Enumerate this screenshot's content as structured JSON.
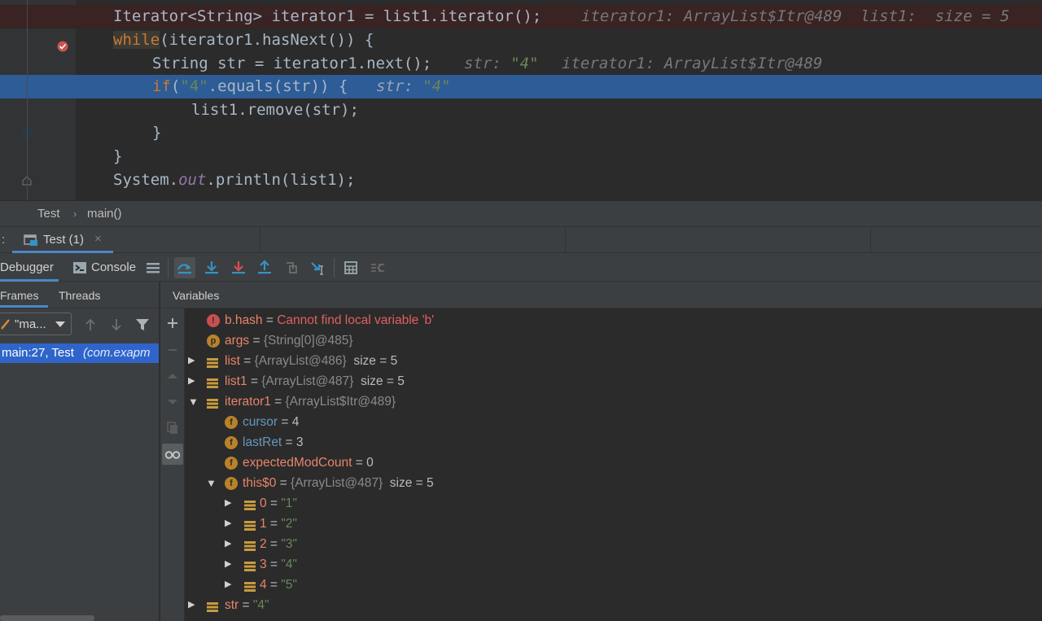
{
  "editor": {
    "lines": [
      {
        "code": "Iterator<String> iterator1 = list1.iterator();",
        "hint": "iterator1: ArrayList$Itr@489  list1:  size = 5"
      },
      {
        "code_kw": "while",
        "code_rest": "(iterator1.hasNext()) {"
      },
      {
        "code": "String str = iterator1.next();",
        "hint_a": "str: ",
        "hint_a_val": "\"4\"",
        "hint_b": "iterator1: ArrayList$Itr@489"
      },
      {
        "code_kw": "if",
        "code_paren": "(",
        "code_str": "\"4\"",
        "code_rest": ".equals(str)) {",
        "hint_a": "str: ",
        "hint_a_val": "\"4\""
      },
      {
        "code": "list1.remove(str);"
      },
      {
        "code": "}"
      },
      {
        "code": "}"
      },
      {
        "code_a": "System.",
        "code_fld": "out",
        "code_b": ".println(list1);"
      }
    ]
  },
  "breadcrumb": {
    "items": [
      "Test",
      "main()"
    ],
    "separator": "›"
  },
  "run_tabs": {
    "prefix": ":",
    "tabs": [
      {
        "label": "Test (1)",
        "close": "×"
      }
    ]
  },
  "debugger_tabs": {
    "debugger": "Debugger",
    "console": "Console"
  },
  "frames_panel": {
    "tabs": [
      "Frames",
      "Threads"
    ],
    "thread_select": "\"ma...",
    "frame": {
      "location": "main:27, Test",
      "package": "(com.exapm"
    }
  },
  "variables_panel": {
    "title": "Variables",
    "rows": [
      {
        "name": "b.hash",
        "eq": " = ",
        "error": "Cannot find local variable 'b'"
      },
      {
        "name": "args",
        "eq": " = ",
        "ref": "{String[0]@485}"
      },
      {
        "name": "list",
        "eq": " = ",
        "ref": "{ArrayList@486}",
        "size": "size = 5"
      },
      {
        "name": "list1",
        "eq": " = ",
        "ref": "{ArrayList@487}",
        "size": "size = 5"
      },
      {
        "name": "iterator1",
        "eq": " = ",
        "ref": "{ArrayList$Itr@489}"
      },
      {
        "name": "cursor",
        "eq": " = ",
        "val": "4"
      },
      {
        "name": "lastRet",
        "eq": " = ",
        "val": "3"
      },
      {
        "name": "expectedModCount",
        "eq": " = ",
        "val": "0"
      },
      {
        "name": "this$0",
        "eq": " = ",
        "ref": "{ArrayList@487}",
        "size": "size = 5"
      },
      {
        "name": "0",
        "eq": " = ",
        "str": "\"1\""
      },
      {
        "name": "1",
        "eq": " = ",
        "str": "\"2\""
      },
      {
        "name": "2",
        "eq": " = ",
        "str": "\"3\""
      },
      {
        "name": "3",
        "eq": " = ",
        "str": "\"4\""
      },
      {
        "name": "4",
        "eq": " = ",
        "str": "\"5\""
      },
      {
        "name": "str",
        "eq": " = ",
        "str": "\"4\""
      }
    ]
  },
  "icons": {
    "field": "f",
    "param": "p",
    "error": "!"
  },
  "colors": {
    "execution_line": "#2d5c96",
    "breakpoint_line": "#3a2323",
    "selected_frame": "#2f65ca",
    "tab_underline": "#4a88c7"
  }
}
